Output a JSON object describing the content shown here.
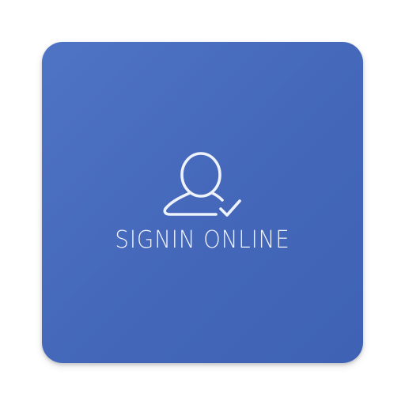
{
  "app_icon": {
    "label": "SIGNIN ONLINE",
    "glyph": "user-check-icon",
    "background_color": "#4467b9",
    "foreground_color": "#eef2fb"
  }
}
